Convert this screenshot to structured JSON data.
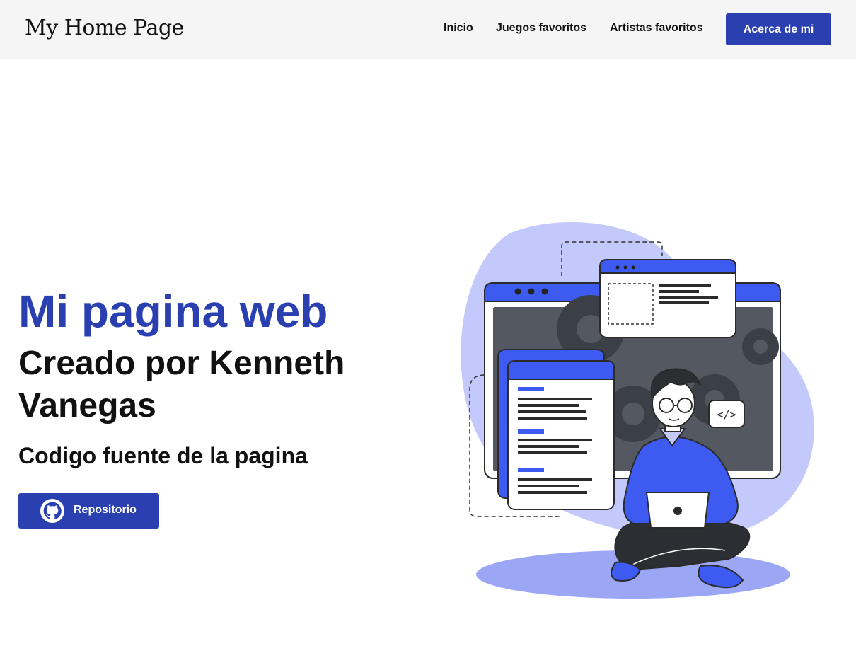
{
  "navbar": {
    "brand": "My Home Page",
    "links": [
      {
        "label": "Inicio"
      },
      {
        "label": "Juegos favoritos"
      },
      {
        "label": "Artistas favoritos"
      }
    ],
    "cta_label": "Acerca de mi"
  },
  "hero": {
    "title": "Mi pagina web",
    "subtitle": "Creado por Kenneth Vanegas",
    "code_label": "Codigo fuente de la pagina",
    "repo_button": {
      "label": "Repositorio",
      "icon": "github-icon"
    },
    "illustration": {
      "code_tag": "</>"
    }
  },
  "colors": {
    "accent": "#2a3fb0",
    "accent_light": "#c3c9fb",
    "accent_bright": "#3d5af1",
    "navbar_bg": "#f5f5f5",
    "text": "#111111"
  }
}
